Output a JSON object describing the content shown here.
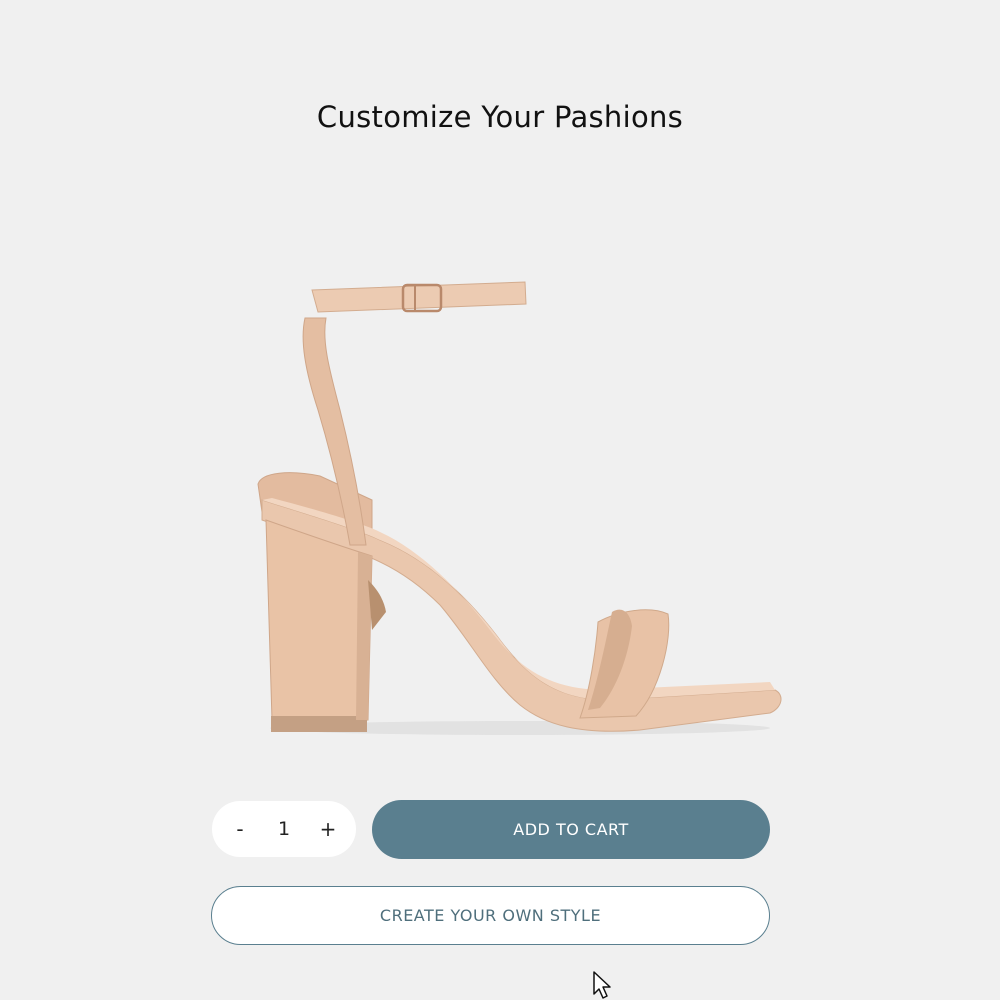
{
  "page": {
    "title": "Customize Your Pashions"
  },
  "product": {
    "image_icon": "block-heel-ankle-strap-sandal",
    "color": "#e8c3a8"
  },
  "quantity": {
    "decrement_label": "-",
    "value": "1",
    "increment_label": "+"
  },
  "actions": {
    "add_to_cart_label": "ADD TO CART",
    "create_style_label": "CREATE YOUR OWN STYLE"
  },
  "colors": {
    "background": "#f0f0f0",
    "accent": "#5a7f8f"
  },
  "pointer": {
    "icon": "mouse-pointer-icon"
  }
}
